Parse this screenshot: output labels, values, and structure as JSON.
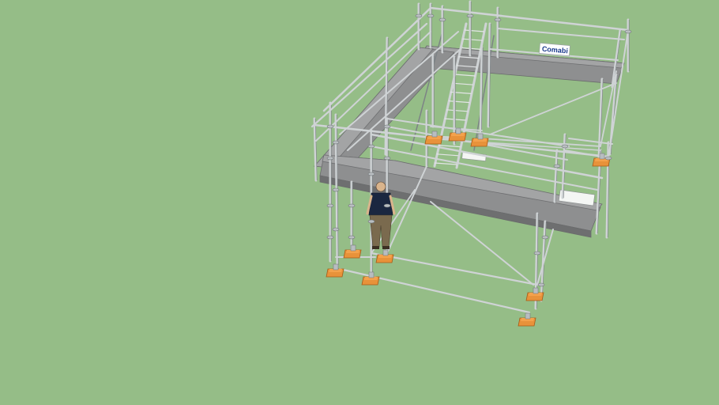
{
  "viewer": {
    "background_color": "#95bd87",
    "model": {
      "subject": "scaffolding-tower-with-stair",
      "brand_sign": {
        "text": "Comabi",
        "text_color": "#1a3a8c",
        "panel_color": "#ffffff"
      },
      "colors": {
        "tube": "#cfd3d5",
        "deck": "#8e8f90",
        "base_plate": "#e8923a",
        "person_shirt": "#1b2740",
        "person_trousers": "#7a6a4e"
      }
    }
  }
}
